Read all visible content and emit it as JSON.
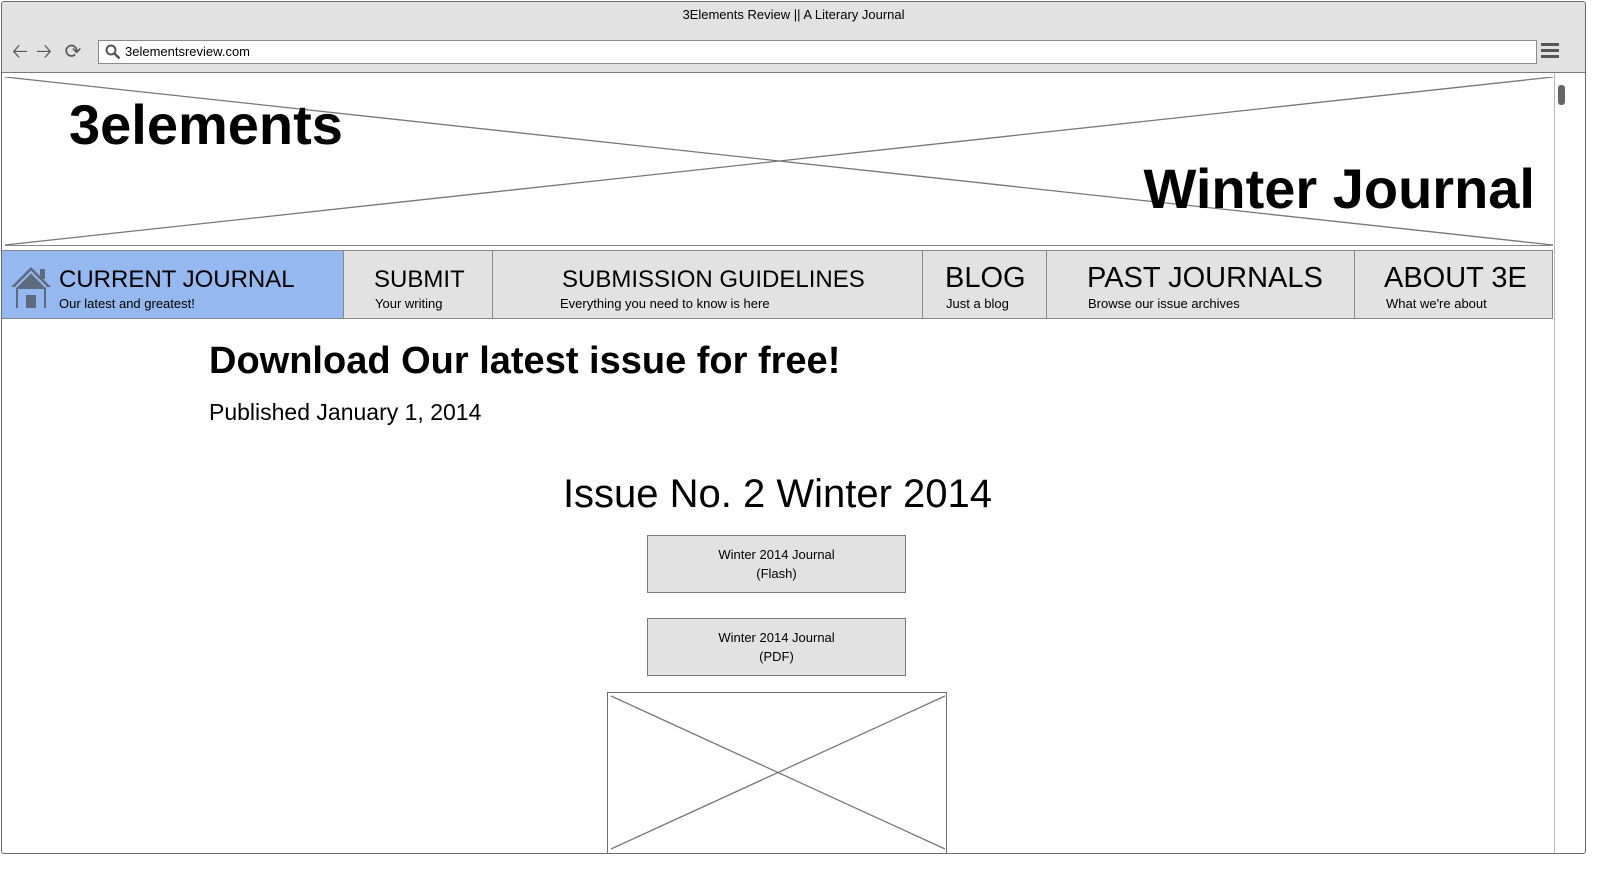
{
  "browser": {
    "window_title": "3Elements Review || A Literary Journal",
    "url": "3elementsreview.com",
    "icons": {
      "back": "back-arrow-icon",
      "forward": "forward-arrow-icon",
      "reload": "reload-icon",
      "search": "search-icon",
      "menu": "hamburger-menu-icon"
    }
  },
  "header": {
    "logo_text": "3elements",
    "banner_title": "Winter Journal"
  },
  "nav": {
    "items": [
      {
        "title": "CURRENT JOURNAL",
        "subtitle": "Our latest and greatest!",
        "active": true,
        "icon": "home-icon"
      },
      {
        "title": "SUBMIT",
        "subtitle": "Your writing"
      },
      {
        "title": "SUBMISSION GUIDELINES",
        "subtitle": "Everything you need to know is here"
      },
      {
        "title": "BLOG",
        "subtitle": "Just a blog"
      },
      {
        "title": "PAST JOURNALS",
        "subtitle": "Browse our issue archives"
      },
      {
        "title": "ABOUT 3E",
        "subtitle": "What we're about"
      }
    ],
    "active_color": "#94b8ef"
  },
  "main": {
    "headline": "Download Our latest issue for free!",
    "published": "Published January 1, 2014",
    "issue_title": "Issue No. 2 Winter 2014",
    "buttons": [
      {
        "line1": "Winter 2014 Journal",
        "line2": "(Flash)"
      },
      {
        "line1": "Winter 2014 Journal",
        "line2": "(PDF)"
      }
    ]
  }
}
